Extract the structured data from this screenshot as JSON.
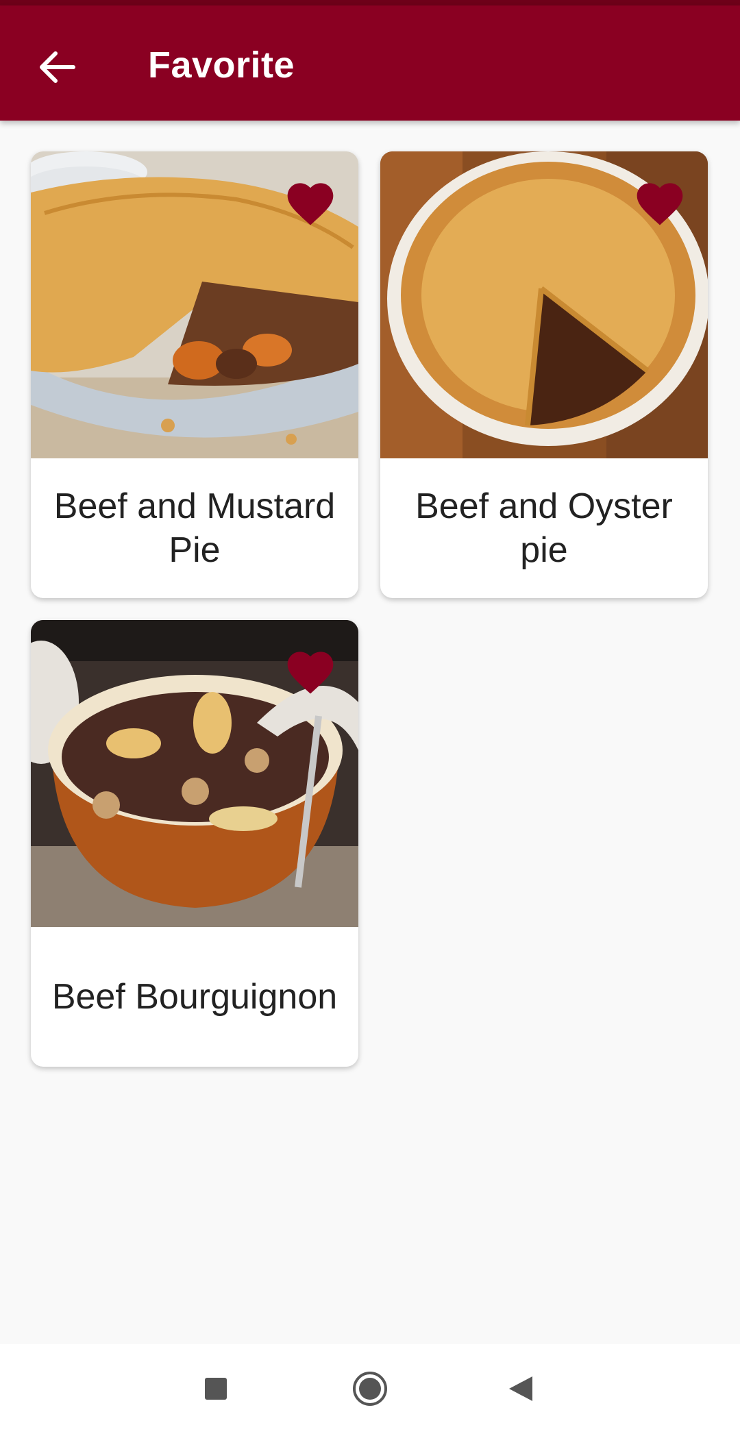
{
  "app_bar": {
    "title": "Favorite",
    "back_icon": "arrow-left-icon"
  },
  "theme": {
    "primary": "#8a0022",
    "status_bar": "#6e0019",
    "heart": "#8a0022",
    "background": "#f9f9f9"
  },
  "recipes": [
    {
      "name": "Beef and Mustard Pie",
      "favorite": true
    },
    {
      "name": "Beef and Oyster pie",
      "favorite": true
    },
    {
      "name": "Beef Bourguignon",
      "favorite": true
    }
  ],
  "nav_bar": {
    "items": [
      "recents-square-icon",
      "home-circle-icon",
      "back-triangle-icon"
    ]
  }
}
